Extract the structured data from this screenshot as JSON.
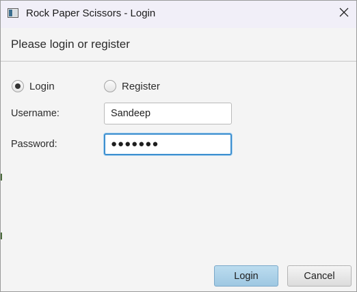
{
  "window": {
    "title": "Rock Paper Scissors - Login",
    "app_icon": "java-app-icon",
    "close_icon": "close-icon"
  },
  "header": {
    "text": "Please login or register"
  },
  "mode": {
    "options": [
      {
        "label": "Login",
        "checked": true
      },
      {
        "label": "Register",
        "checked": false
      }
    ]
  },
  "form": {
    "username_label": "Username:",
    "username_value": "Sandeep",
    "password_label": "Password:",
    "password_value": "●●●●●●●"
  },
  "buttons": {
    "login_label": "Login",
    "cancel_label": "Cancel"
  },
  "colors": {
    "accent": "#3d8fcf",
    "default_button": "#a9d1e8"
  }
}
